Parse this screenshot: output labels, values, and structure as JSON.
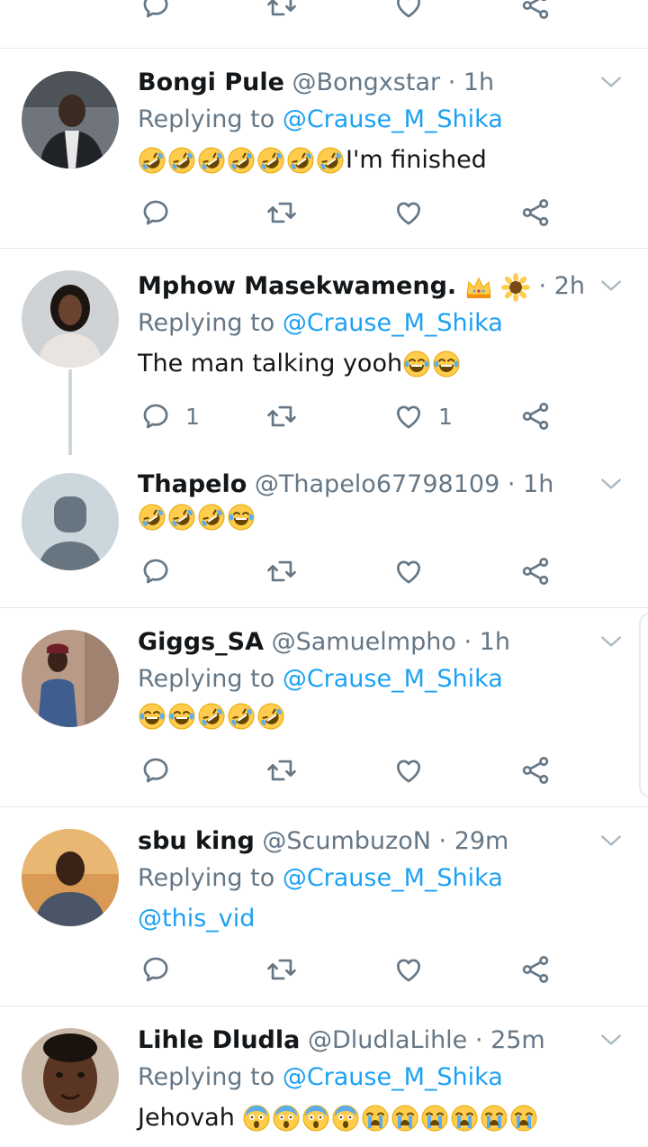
{
  "top_actions": {
    "reply_icon": "reply-icon",
    "retweet_icon": "retweet-icon",
    "like_icon": "heart-icon",
    "share_icon": "share-icon"
  },
  "tweets": [
    {
      "name": "Bongi Pule",
      "handle": "@Bongxstar",
      "dot": "·",
      "time": "1h",
      "replying_prefix": "Replying to",
      "replying_handle": "@Crause_M_Shika",
      "text": "I'm finished",
      "emojis": [
        "rofl",
        "rofl",
        "rofl",
        "rofl",
        "rofl",
        "rofl",
        "rofl"
      ],
      "reply_count": "",
      "like_count": ""
    },
    {
      "name": "Mphow Masekwameng.",
      "name_emojis": [
        "crown",
        "sunflower"
      ],
      "ellipsis": "...",
      "handle": "",
      "dot": "·",
      "time": "2h",
      "replying_prefix": "Replying to",
      "replying_handle": "@Crause_M_Shika",
      "text": "The man talking yooh",
      "emojis": [
        "joy",
        "joy"
      ],
      "reply_count": "1",
      "like_count": "1"
    },
    {
      "name": "Thapelo",
      "handle": "@Thapelo67798109",
      "dot": "·",
      "time": "1h",
      "text": "",
      "emojis": [
        "rofl",
        "rofl",
        "rofl",
        "joy"
      ],
      "reply_count": "",
      "like_count": ""
    },
    {
      "name": "Giggs_SA",
      "handle": "@Samuelmpho",
      "dot": "·",
      "time": "1h",
      "replying_prefix": "Replying to",
      "replying_handle": "@Crause_M_Shika",
      "text": "",
      "emojis": [
        "joy",
        "joy",
        "rofl",
        "rofl",
        "rofl"
      ],
      "reply_count": "",
      "like_count": ""
    },
    {
      "name": "sbu king",
      "handle": "@ScumbuzoN",
      "dot": "·",
      "time": "29m",
      "replying_prefix": "Replying to",
      "replying_handle": "@Crause_M_Shika",
      "mention_text": "@this_vid",
      "reply_count": "",
      "like_count": ""
    },
    {
      "name": "Lihle Dludla",
      "handle": "@DludlaLihle",
      "dot": "·",
      "time": "25m",
      "replying_prefix": "Replying to",
      "replying_handle": "@Crause_M_Shika",
      "text": "Jehovah ",
      "emojis": [
        "scream",
        "scream",
        "scream",
        "scream",
        "sob",
        "sob",
        "sob",
        "sob",
        "sob",
        "sob"
      ]
    }
  ],
  "colors": {
    "link": "#1da1f2",
    "secondary": "#657786",
    "divider": "#e1e8ed",
    "thread": "#ccd6dd"
  }
}
